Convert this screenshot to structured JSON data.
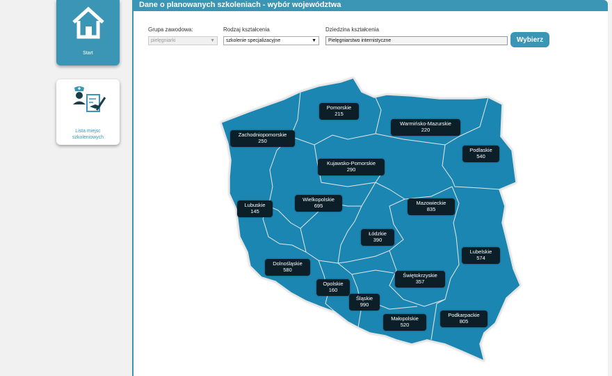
{
  "sidebar": {
    "start_label": "Start",
    "list_label_1": "Lista miejsc",
    "list_label_2": "szkoleniowych"
  },
  "header": {
    "title": "Dane o planowanych szkoleniach - wybór województwa"
  },
  "filters": {
    "group_label": "Grupa zawodowa:",
    "group_value": "pielęgniarki",
    "type_label": "Rodzaj kształcenia",
    "type_value": "szkolenie specjalizacyjne",
    "field_label": "Dziedzina kształcenia",
    "field_value": "Pielęgniarstwo internistyczne",
    "submit_label": "Wybierz"
  },
  "colors": {
    "accent": "#3b95b5",
    "map_fill": "#1e86b3",
    "label_bg": "#0c1e28"
  },
  "regions": [
    {
      "name": "Pomorskie",
      "value": "215"
    },
    {
      "name": "Warmińsko-Mazurskie",
      "value": "220"
    },
    {
      "name": "Zachodniopomorskie",
      "value": "250"
    },
    {
      "name": "Podlaskie",
      "value": "540"
    },
    {
      "name": "Kujawsko-Pomorskie",
      "value": "290"
    },
    {
      "name": "Wielkopolskie",
      "value": "695"
    },
    {
      "name": "Lubuskie",
      "value": "145"
    },
    {
      "name": "Mazowieckie",
      "value": "835"
    },
    {
      "name": "Łódzkie",
      "value": "390"
    },
    {
      "name": "Lubelskie",
      "value": "574"
    },
    {
      "name": "Dolnośląskie",
      "value": "580"
    },
    {
      "name": "Świętokrzyskie",
      "value": "357"
    },
    {
      "name": "Opolskie",
      "value": "160"
    },
    {
      "name": "Śląskie",
      "value": "990"
    },
    {
      "name": "Małopolskie",
      "value": "520"
    },
    {
      "name": "Podkarpackie",
      "value": "805"
    }
  ]
}
